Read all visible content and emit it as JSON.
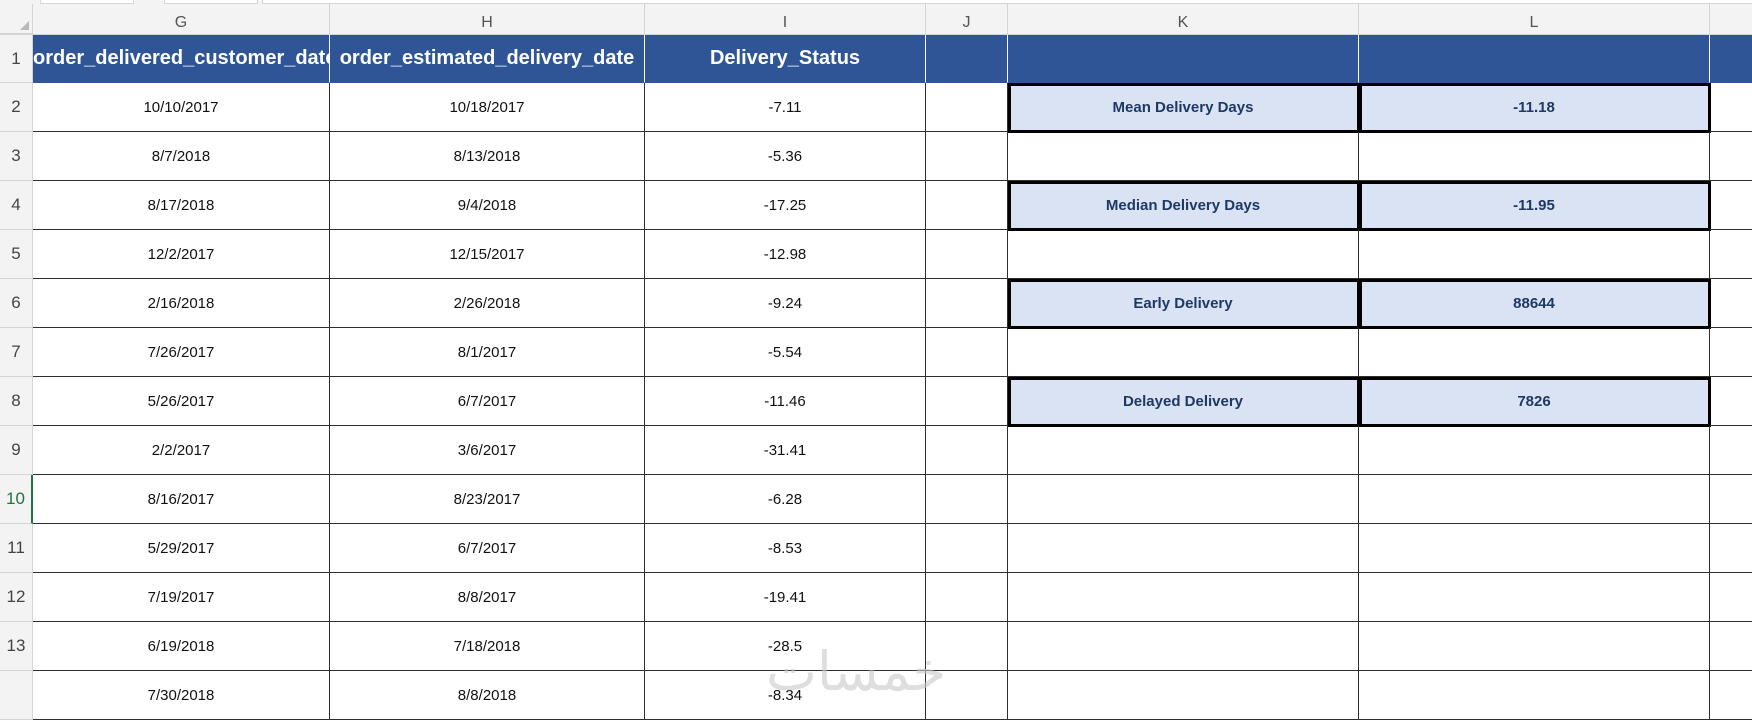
{
  "columns": [
    "G",
    "H",
    "I",
    "J",
    "K",
    "L"
  ],
  "row_numbers": [
    "1",
    "2",
    "3",
    "4",
    "5",
    "6",
    "7",
    "8",
    "9",
    "10",
    "11",
    "12",
    "13",
    ""
  ],
  "headers": {
    "g": "order_delivered_customer_date",
    "h": "order_estimated_delivery_date",
    "i": "Delivery_Status"
  },
  "rows": [
    {
      "g": "10/10/2017",
      "h": "10/18/2017",
      "i": "-7.11"
    },
    {
      "g": "8/7/2018",
      "h": "8/13/2018",
      "i": "-5.36"
    },
    {
      "g": "8/17/2018",
      "h": "9/4/2018",
      "i": "-17.25"
    },
    {
      "g": "12/2/2017",
      "h": "12/15/2017",
      "i": "-12.98"
    },
    {
      "g": "2/16/2018",
      "h": "2/26/2018",
      "i": "-9.24"
    },
    {
      "g": "7/26/2017",
      "h": "8/1/2017",
      "i": "-5.54"
    },
    {
      "g": "5/26/2017",
      "h": "6/7/2017",
      "i": "-11.46"
    },
    {
      "g": "2/2/2017",
      "h": "3/6/2017",
      "i": "-31.41"
    },
    {
      "g": "8/16/2017",
      "h": "8/23/2017",
      "i": "-6.28"
    },
    {
      "g": "5/29/2017",
      "h": "6/7/2017",
      "i": "-8.53"
    },
    {
      "g": "7/19/2017",
      "h": "8/8/2017",
      "i": "-19.41"
    },
    {
      "g": "6/19/2018",
      "h": "7/18/2018",
      "i": "-28.5"
    },
    {
      "g": "7/30/2018",
      "h": "8/8/2018",
      "i": "-8.34"
    }
  ],
  "summary": {
    "mean_label": "Mean Delivery Days",
    "mean_value": "-11.18",
    "median_label": "Median Delivery Days",
    "median_value": "-11.95",
    "early_label": "Early Delivery",
    "early_value": "88644",
    "delayed_label": "Delayed Delivery",
    "delayed_value": "7826"
  },
  "watermark": "خمسات",
  "colors": {
    "header_fill": "#2f5597",
    "summary_fill": "#dae3f3",
    "summary_text": "#1f3864",
    "active_row": "#217346"
  }
}
